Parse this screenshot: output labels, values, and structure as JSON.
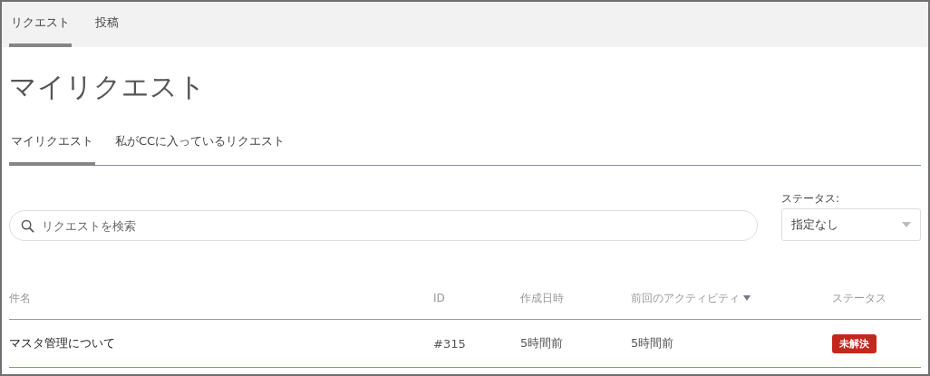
{
  "top_tabs": [
    {
      "label": "リクエスト",
      "selected": true
    },
    {
      "label": "投稿",
      "selected": false
    }
  ],
  "title": "マイリクエスト",
  "sub_tabs": [
    {
      "label": "マイリクエスト",
      "selected": true
    },
    {
      "label": "私がCCに入っているリクエスト",
      "selected": false
    }
  ],
  "search": {
    "placeholder": "リクエストを検索"
  },
  "status_filter": {
    "label": "ステータス:",
    "value": "指定なし"
  },
  "table": {
    "columns": [
      {
        "label": "件名",
        "sorted": false
      },
      {
        "label": "ID",
        "sorted": false
      },
      {
        "label": "作成日時",
        "sorted": false
      },
      {
        "label": "前回のアクティビティ",
        "sorted": true
      },
      {
        "label": "ステータス",
        "sorted": false
      }
    ],
    "rows": [
      {
        "subject": "マスタ管理について",
        "id": "#315",
        "created": "5時間前",
        "activity": "5時間前",
        "status": "未解決"
      }
    ]
  }
}
